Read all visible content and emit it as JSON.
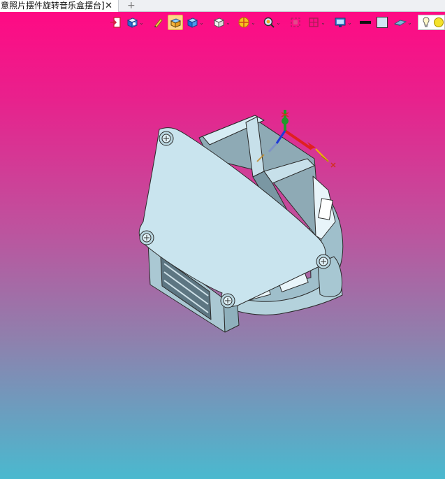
{
  "tab": {
    "title": "意照片摆件旋转音乐盒摆台]",
    "close_glyph": "✕",
    "new_tab_glyph": "+"
  },
  "toolbar": {
    "items": [
      {
        "icon": "exit-sketch-icon",
        "dropdown": false
      },
      {
        "icon": "view-orient-icon",
        "dropdown": true
      },
      {
        "icon": "pencil-icon",
        "dropdown": false
      },
      {
        "icon": "render-mode-icon",
        "dropdown": false,
        "selected": true
      },
      {
        "icon": "shaded-cube-icon",
        "dropdown": true
      },
      {
        "icon": "white-cube-icon",
        "dropdown": true
      },
      {
        "icon": "section-view-icon",
        "dropdown": true
      },
      {
        "icon": "zoom-magnifier-icon",
        "dropdown": true
      },
      {
        "icon": "zoom-fit-icon",
        "dropdown": false
      },
      {
        "icon": "layers-icon",
        "dropdown": true
      },
      {
        "icon": "display-monitor-icon",
        "dropdown": true
      },
      {
        "icon": "black-line-swatch-icon",
        "dropdown": false
      },
      {
        "icon": "background-swatch-icon",
        "dropdown": false
      },
      {
        "icon": "plane-icon",
        "dropdown": true
      },
      {
        "icon": "bulb-icon",
        "dropdown": false
      },
      {
        "icon": "sun-icon",
        "dropdown": false
      }
    ],
    "dropdown_glyph": "⌄"
  },
  "colors": {
    "gradient_top": "#ff0a84",
    "gradient_bottom": "#4ab9cf",
    "model_face": "#c9e4ee",
    "model_edge": "#2b2b2b",
    "model_shadow": "#8fb3c1",
    "axis_x": "#e02020",
    "axis_y": "#1f9a2a",
    "axis_z": "#1e3ad6"
  }
}
